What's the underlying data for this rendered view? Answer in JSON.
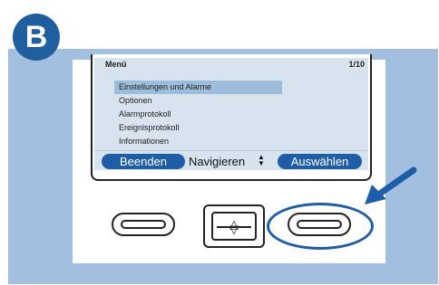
{
  "badge": {
    "label": "B"
  },
  "screen": {
    "header": {
      "title": "Menü",
      "page": "1/10"
    },
    "menu_items": [
      {
        "label": "Einstellungen und Alarme",
        "selected": true
      },
      {
        "label": "Optionen",
        "selected": false
      },
      {
        "label": "Alarmprotokoll",
        "selected": false
      },
      {
        "label": "Ereignisprotokoll",
        "selected": false
      },
      {
        "label": "Informationen",
        "selected": false
      }
    ],
    "softkeys": {
      "left": "Beenden",
      "center": "Navigieren",
      "center_icon": "up-down-arrows-icon",
      "right": "Auswählen"
    }
  },
  "hardware_buttons": {
    "left": "left-softkey-button",
    "center": "navigation-button",
    "right": "right-softkey-button"
  },
  "colors": {
    "background_panel": "#a3bfdf",
    "badge": "#1f5f9f",
    "screen": "#d7e3ef",
    "selected_item": "#9dbddb",
    "softkey": "#1f5ea6",
    "highlight": "#1e5ea8"
  }
}
